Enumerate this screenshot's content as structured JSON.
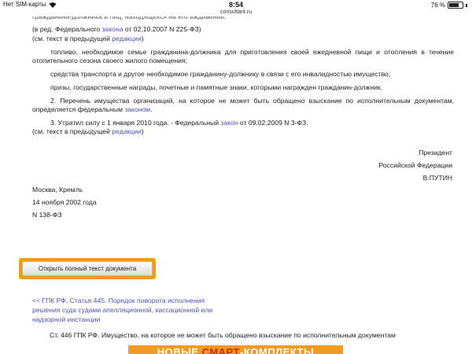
{
  "status_bar": {
    "carrier": "Нет SIM-карты",
    "time": "8:54",
    "url": "consultant.ru",
    "battery_text": "76 %",
    "battery_level": 0.76
  },
  "document": {
    "cut_line": "гражданина-должника и лиц, находящихся на его иждивении;",
    "line1": "(в ред. Федерального ",
    "line1_link": "закона",
    "line1_tail": " от 02.10.2007 N 225-ФЗ)",
    "line2": "(см. текст в предыдущей ",
    "line2_link": "редакции",
    "line2_tail": ")",
    "para_fuel": "топливо, необходимое семье гражданина-должника для приготовления своей ежедневной пищи и отопления в течение отопительного сезона своего жилого помещения;",
    "para_transport": "средства транспорта и другое необходимое гражданину-должнику в связи с его инвалидностью имущество;",
    "para_prizes": "призы, государственные награды, почетные и памятные знаки, которыми награжден гражданин-должник.",
    "para_2": "2. Перечень имущества организаций, на которое не может быть обращено взыскание по исполнительным документам, определяется федеральным ",
    "para_2_link": "законом",
    "para_2_tail": ".",
    "para_3": "3. Утратил силу с 1 января 2010 года. - Федеральный ",
    "para_3_link": "закон",
    "para_3_tail": " от 09.02.2009 N 3-ФЗ.",
    "line_prev": "(см. текст в предыдущей ",
    "line_prev_link": "редакции",
    "line_prev_tail": ")",
    "signature": [
      "Президент",
      "Российской Федерации",
      "В.ПУТИН"
    ],
    "place": "Москва, Кремль",
    "date": "14 ноября 2002 года",
    "number": "N 138-ФЗ"
  },
  "button": {
    "label": "Открыть полный текст документа"
  },
  "navigation": {
    "prev_link_lines": [
      "<< ГПК РФ, Статья 445. Порядок поворота исполнения",
      "решения суда судами апелляционной, кассационной или",
      "надзорной инстанции"
    ],
    "next_title": "Ст. 446 ГПК РФ. Имущество, на которое не может быть обращено взыскание по исполнительным документам"
  },
  "banner": {
    "text_before": "НОВЫЕ ",
    "text_highlight": "СМАРТ",
    "text_after": "-КОМПЛЕКТЫ"
  }
}
